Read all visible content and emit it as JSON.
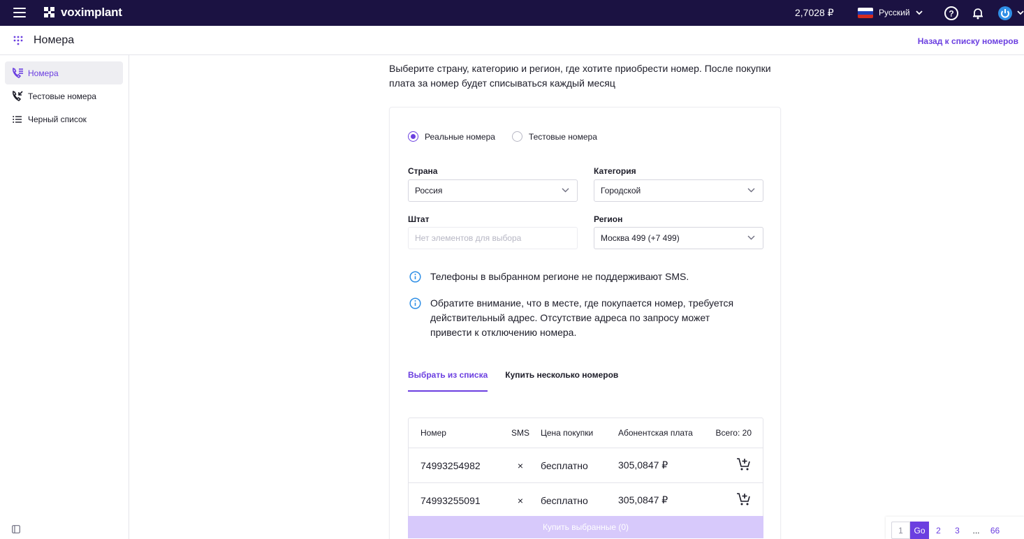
{
  "topbar": {
    "logo_text": "voximplant",
    "balance": "2,7028 ₽",
    "language": "Русский"
  },
  "subheader": {
    "title": "Номера",
    "back_link": "Назад к списку номеров"
  },
  "sidebar": {
    "items": [
      {
        "label": "Номера",
        "icon": "phone-list-icon",
        "active": true
      },
      {
        "label": "Тестовые номера",
        "icon": "phone-incoming-icon",
        "active": false
      },
      {
        "label": "Черный список",
        "icon": "list-icon",
        "active": false
      }
    ]
  },
  "intro": "Выберите страну, категорию и регион, где хотите приобрести номер. После покупки плата за номер будет списываться каждый месяц",
  "form": {
    "radio_real": "Реальные номера",
    "radio_test": "Тестовые номера",
    "country_label": "Страна",
    "country_value": "Россия",
    "category_label": "Категория",
    "category_value": "Городской",
    "state_label": "Штат",
    "state_placeholder": "Нет элементов для выбора",
    "region_label": "Регион",
    "region_value": "Москва 499 (+7 499)"
  },
  "notices": [
    "Телефоны в выбранном регионе не поддерживают SMS.",
    "Обратите внимание, что в месте, где покупается номер, требуется действительный адрес. Отсутствие адреса по запросу может привести к отключению номера."
  ],
  "tabs": {
    "from_list": "Выбрать из списка",
    "buy_multiple": "Купить несколько номеров"
  },
  "table": {
    "headers": {
      "number": "Номер",
      "sms": "SMS",
      "price": "Цена покупки",
      "fee": "Абонентская плата",
      "total": "Всего: 20"
    },
    "rows": [
      {
        "number": "74993254982",
        "sms": "×",
        "price": "бесплатно",
        "fee": "305,0847 ₽"
      },
      {
        "number": "74993255091",
        "sms": "×",
        "price": "бесплатно",
        "fee": "305,0847 ₽"
      }
    ],
    "buy_button": "Купить выбранные (0)"
  },
  "pagination": {
    "first": "1",
    "go": "Go",
    "p2": "2",
    "p3": "3",
    "ellipsis": "...",
    "last": "66"
  },
  "colors": {
    "topbar": "#1b1242",
    "accent": "#6b3fe0",
    "info": "#2f8fe6"
  }
}
